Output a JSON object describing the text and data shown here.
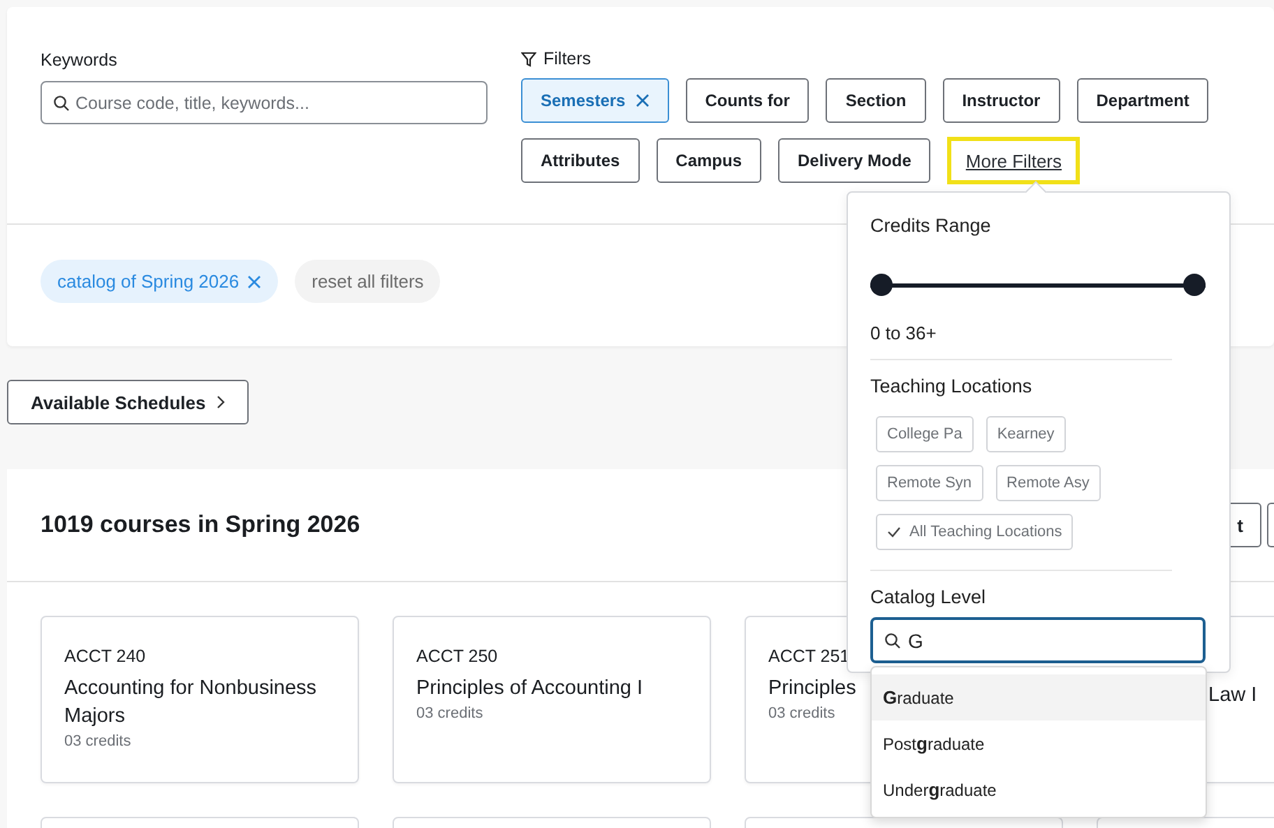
{
  "search": {
    "label": "Keywords",
    "placeholder": "Course code, title, keywords..."
  },
  "filters": {
    "label": "Filters",
    "buttons": [
      {
        "label": "Semesters",
        "selected": true
      },
      {
        "label": "Counts for",
        "selected": false
      },
      {
        "label": "Section",
        "selected": false
      },
      {
        "label": "Instructor",
        "selected": false
      },
      {
        "label": "Department",
        "selected": false
      },
      {
        "label": "Attributes",
        "selected": false
      },
      {
        "label": "Campus",
        "selected": false
      },
      {
        "label": "Delivery Mode",
        "selected": false
      }
    ],
    "more_filters": {
      "label": "More Filters",
      "highlighted": true
    }
  },
  "active_filters": [
    {
      "label": "catalog of Spring 2026",
      "kind": "tag"
    },
    {
      "label": "reset all filters",
      "kind": "reset"
    }
  ],
  "schedules_button": {
    "label": "Available Schedules"
  },
  "results": {
    "title": "1019 courses in Spring 2026",
    "header_buttons": [
      "t"
    ],
    "cards": [
      {
        "code": "ACCT 240",
        "title": "Accounting for Nonbusiness Majors",
        "credits": "03 credits"
      },
      {
        "code": "ACCT 250",
        "title": "Principles of Accounting I",
        "credits": "03 credits"
      },
      {
        "code": "ACCT 251",
        "title": "Principles",
        "credits": "03 credits"
      },
      {
        "title": "Law I",
        "kind": "covered"
      }
    ]
  },
  "more_filters_panel": {
    "credits": {
      "label": "Credits Range",
      "thumbs": [
        {
          "level": 0
        },
        {
          "level": 1
        }
      ],
      "reading": "0 to 36+"
    },
    "locations": {
      "label": "Teaching Locations",
      "options": [
        {
          "label": "College Pa",
          "checked": false
        },
        {
          "label": "Kearney",
          "checked": false
        },
        {
          "label": "Remote Syn",
          "checked": false
        },
        {
          "label": "Remote Asy",
          "checked": false
        },
        {
          "label": "All Teaching Locations",
          "checked": true
        }
      ]
    },
    "catalog_level": {
      "label": "Catalog Level",
      "value": "G",
      "suggestions": [
        {
          "label": "**G**raduate",
          "selected": true
        },
        {
          "label": "Post**g**raduate",
          "selected": false
        },
        {
          "label": "Under**g**raduate",
          "selected": false
        }
      ]
    }
  }
}
